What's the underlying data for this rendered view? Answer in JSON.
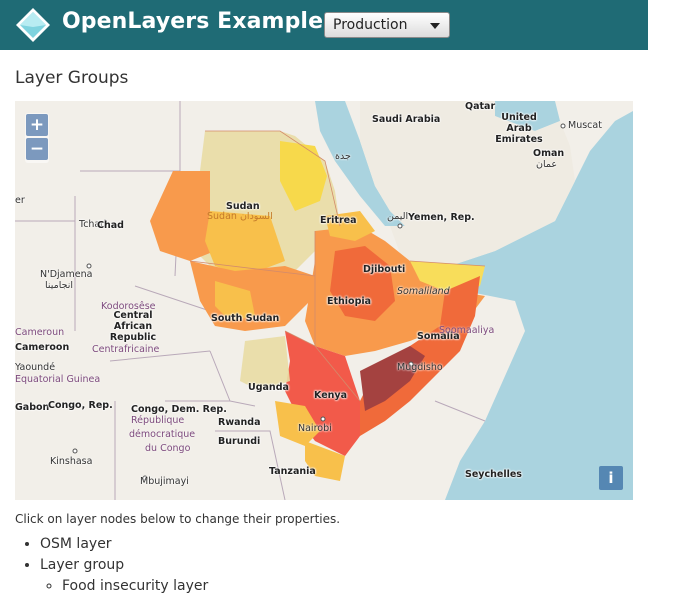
{
  "header": {
    "brand": "OpenLayers Examples",
    "version_select": "Production"
  },
  "page_title": "Layer Groups",
  "map": {
    "zoom_in": "+",
    "zoom_out": "−",
    "info": "i",
    "labels": {
      "qatar": "Qatar",
      "saudi_arabia": "Saudi Arabia",
      "uae": "United Arab Emirates",
      "muscat": "Muscat",
      "oman": "Oman",
      "oman_ar": "عمان",
      "sudan": "Sudan",
      "sudan_ar": "Sudan السودان",
      "chad": "Chad",
      "tchad": "Tchad",
      "eritrea": "Eritrea",
      "yemen": "Yemen, Rep.",
      "yemen_ar": "اليمن",
      "jeddah_ar": "جدة",
      "ndjamena": "N'Djamena",
      "ndjamena_ar": "انجامينا",
      "djibouti": "Djibouti",
      "somaliland": "Somaliland",
      "ethiopia": "Ethiopia",
      "kodorosese": "Kodorosêse",
      "car": "Central African Republic",
      "centrafricaine": "Centrafricaine",
      "south_sudan": "South Sudan",
      "somalia": "Somalia",
      "somalia_ar": "Soomaaliya",
      "cameroon": "Cameroun",
      "cameroon2": "Cameroon",
      "yaounde": "Yaoundé",
      "equatorial": "Equatorial Guinea",
      "mogadishu": "Mugdisho",
      "uganda": "Uganda",
      "kenya": "Kenya",
      "gabon": "Gabon",
      "congo_rep": "Congo, Rep.",
      "congo_dem": "Congo, Dem. Rep.",
      "rdc1": "République",
      "rdc2": "démocratique",
      "rdc3": "du Congo",
      "rwanda": "Rwanda",
      "burundi": "Burundi",
      "nairobi": "Nairobi",
      "kinshasa": "Kinshasa",
      "tanzania": "Tanzania",
      "seychelles": "Seychelles",
      "mbujimayi": "Mbujimayi",
      "edge_er": "er"
    }
  },
  "instructions": "Click on layer nodes below to change their properties.",
  "layers": {
    "osm": "OSM layer",
    "group": "Layer group",
    "food": "Food insecurity layer"
  }
}
